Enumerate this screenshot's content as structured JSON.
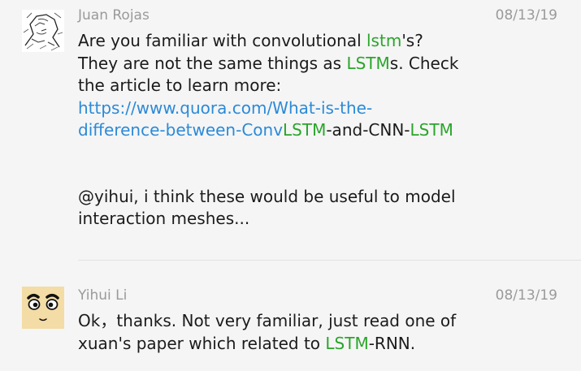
{
  "messages": [
    {
      "sender": "Juan Rojas",
      "timestamp": "08/13/19",
      "avatar_icon": "sketch-portrait-avatar",
      "lines": {
        "l1_a": "Are you familiar with convolutional ",
        "l1_hl": "lstm",
        "l1_b": "'s?",
        "l2_a": "They are not the same things as ",
        "l2_hl": "LSTM",
        "l2_b": "s. Check",
        "l3": "the article to learn more:",
        "link_line1": "https://www.quora.com/What-is-the-",
        "link_line2_a": "difference-between-Conv",
        "link_line2_hl1": "LSTM",
        "link_line2_b": "-and-CNN-",
        "link_line2_hl2": "LSTM",
        "l6": "@yihui, i think these would be useful to model",
        "l7": "interaction meshes..."
      }
    },
    {
      "sender": "Yihui Li",
      "timestamp": "08/13/19",
      "avatar_icon": "cartoon-face-avatar",
      "lines": {
        "l1": "Ok，thanks. Not very familiar, just read one of",
        "l2_a": "xuan's paper which related to ",
        "l2_hl": "LSTM",
        "l2_b": "-RNN."
      }
    }
  ],
  "colors": {
    "background": "#f5f5f5",
    "keyword_highlight": "#2aa52a",
    "link": "#2b8ad8",
    "meta_text": "#9a9a9a",
    "body_text": "#1b1b1b"
  }
}
